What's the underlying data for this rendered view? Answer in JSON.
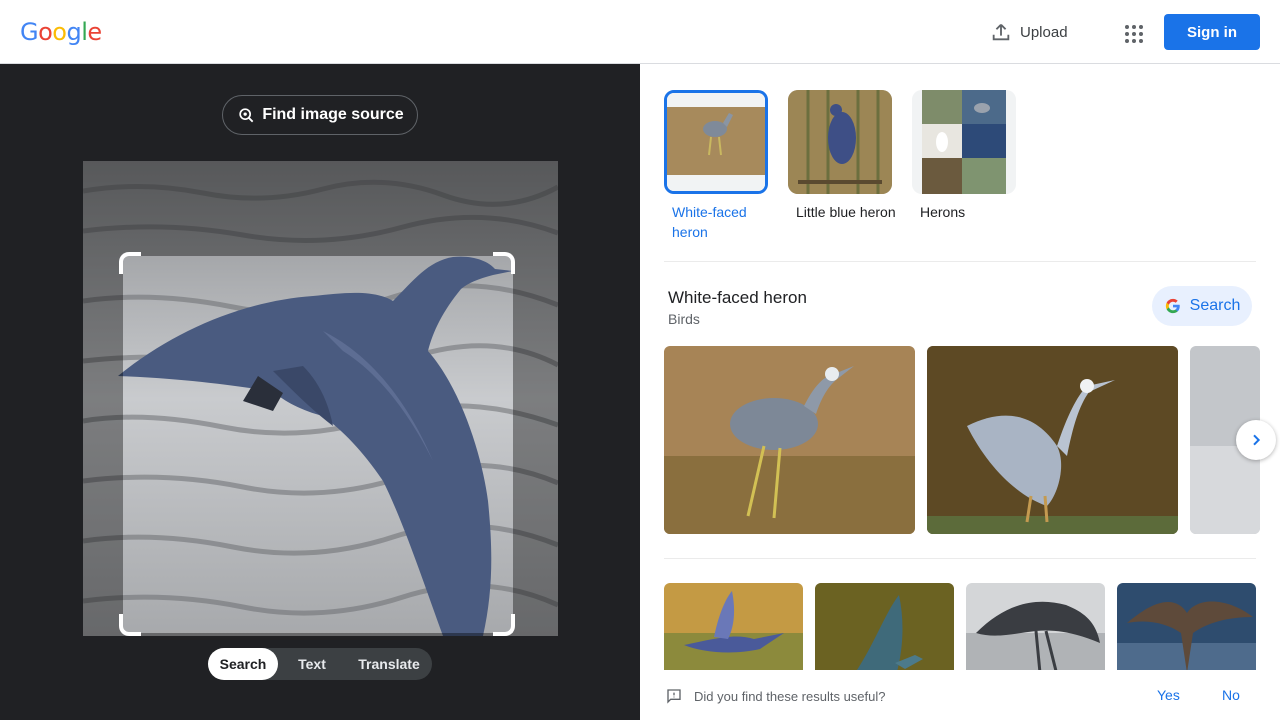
{
  "header": {
    "logo_letters": [
      "G",
      "o",
      "o",
      "g",
      "l",
      "e"
    ],
    "logo_colors": [
      "#4285f4",
      "#ea4335",
      "#fbbc05",
      "#4285f4",
      "#34a853",
      "#ea4335"
    ],
    "upload_label": "Upload",
    "apps_icon": "apps-grid-icon",
    "signin_label": "Sign in"
  },
  "lens": {
    "find_source_label": "Find image source",
    "modes": [
      "Search",
      "Text",
      "Translate"
    ],
    "active_mode": "Search"
  },
  "results": {
    "chips": [
      {
        "label": "White-faced heron",
        "selected": true
      },
      {
        "label": "Little blue heron",
        "selected": false
      },
      {
        "label": "Herons",
        "selected": false
      }
    ],
    "kg_title": "White-faced heron",
    "kg_subtitle": "Birds",
    "search_button_label": "Search",
    "feedback_question": "Did you find these results useful?",
    "feedback_yes": "Yes",
    "feedback_no": "No"
  },
  "colors": {
    "accent": "#1a73e8",
    "dark_panel": "#202124"
  }
}
